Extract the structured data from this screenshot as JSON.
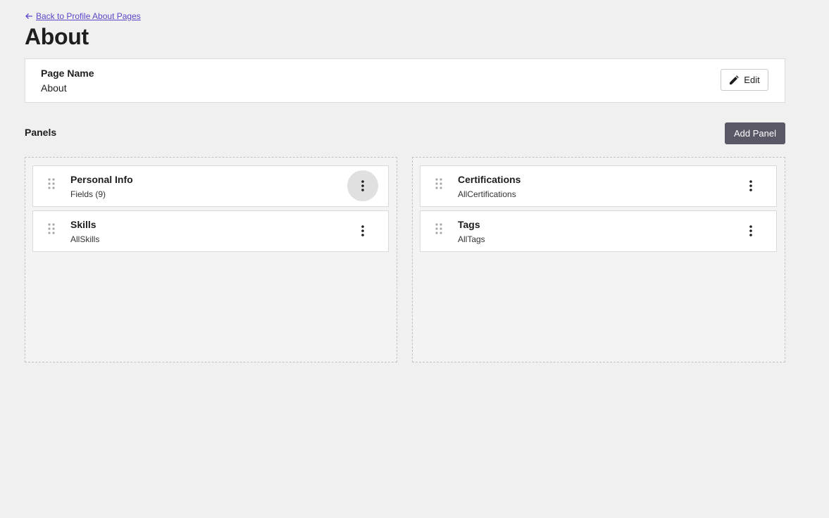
{
  "back_link": {
    "label": "Back to Profile About Pages",
    "icon": "arrow-left-icon"
  },
  "page_title": "About",
  "page_name_card": {
    "label": "Page Name",
    "value": "About",
    "edit_label": "Edit",
    "edit_icon": "pencil-icon"
  },
  "panels_section": {
    "label": "Panels",
    "add_button_label": "Add Panel"
  },
  "columns": [
    {
      "panels": [
        {
          "title": "Personal Info",
          "subtitle": "Fields (9)",
          "menu_active": true
        },
        {
          "title": "Skills",
          "subtitle": "AllSkills",
          "menu_active": false
        }
      ]
    },
    {
      "panels": [
        {
          "title": "Certifications",
          "subtitle": "AllCertifications",
          "menu_active": false
        },
        {
          "title": "Tags",
          "subtitle": "AllTags",
          "menu_active": false
        }
      ]
    }
  ],
  "colors": {
    "link": "#5c45c8",
    "primary_button": "#5a5766",
    "background": "#f0f0f0"
  }
}
